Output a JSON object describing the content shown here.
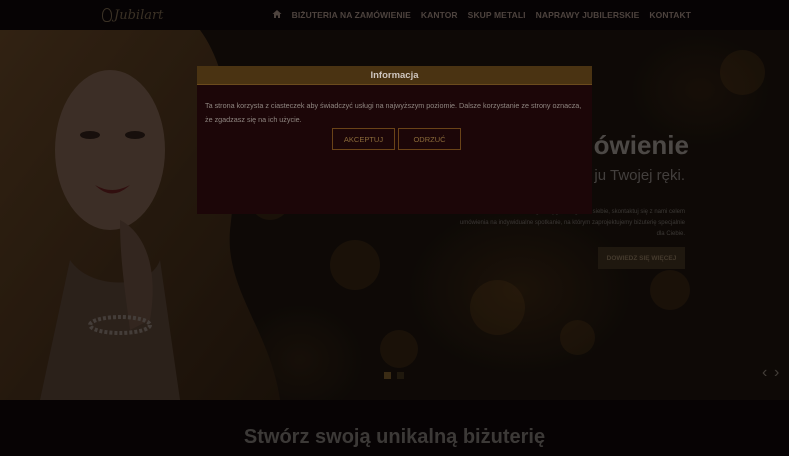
{
  "brand": {
    "logo_text": "Jubilart"
  },
  "nav": {
    "items": [
      {
        "label": "BIŻUTERIA NA ZAMÓWIENIE"
      },
      {
        "label": "KANTOR"
      },
      {
        "label": "SKUP METALI"
      },
      {
        "label": "NAPRAWY JUBILERSKIE"
      },
      {
        "label": "KONTAKT"
      }
    ]
  },
  "hero": {
    "title": "ówienie",
    "subtitle": "ju Twojej ręki.",
    "description": "ta. Jeśli nie znalazłaś / eś czegoś oryginalnego dla siebie, skontaktuj się z nami celem umówienia na indywidualne spotkanie, na którym zaprojektujemy biżuterię specjalnie dla Ciebie.",
    "cta_label": "DOWIEDZ SIĘ WIĘCEJ"
  },
  "section": {
    "title": "Stwórz swoją unikalną biżuterię"
  },
  "modal": {
    "title": "Informacja",
    "message": "Ta strona korzysta z ciasteczek aby świadczyć usługi na najwyższym poziomie. Dalsze korzystanie ze strony oznacza, że zgadzasz się na ich użycie.",
    "accept_label": "AKCEPTUJ",
    "reject_label": "ODRZUĆ"
  },
  "colors": {
    "accent_gold": "#4a3312",
    "modal_bg": "#1c0608",
    "page_bg": "#0d0708"
  }
}
